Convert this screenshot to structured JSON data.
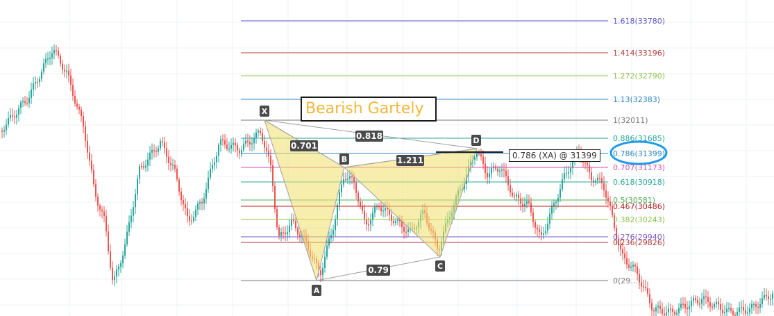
{
  "pattern_title": "Bearish Gartely",
  "annotation": "0.786 (XA) @ 31399",
  "points": {
    "x": "X",
    "a": "A",
    "b": "B",
    "c": "C",
    "d": "D"
  },
  "ratios": {
    "xb": "0.701",
    "xd": "0.818",
    "bd": "1.211",
    "ac": "0.79"
  },
  "fib_levels": [
    {
      "label": "1.618(33780)",
      "color": "#5a55c8"
    },
    {
      "label": "1.414(33196)",
      "color": "#b23a3a"
    },
    {
      "label": "1.272(32790)",
      "color": "#8bc34a"
    },
    {
      "label": "1.13(32383)",
      "color": "#2e86c1"
    },
    {
      "label": "1(32011)",
      "color": "#777777"
    },
    {
      "label": "0.886(31685)",
      "color": "#26a69a"
    },
    {
      "label": "0.786(31399)",
      "color": "#2e86c1"
    },
    {
      "label": "0.707(31173)",
      "color": "#d14fb2"
    },
    {
      "label": "0.618(30918)",
      "color": "#26a69a"
    },
    {
      "label": "0.5(30581)",
      "color": "#4caf50"
    },
    {
      "label": "0.467(30486)",
      "color": "#b71c1c"
    },
    {
      "label": "0.382(30243)",
      "color": "#8bc34a"
    },
    {
      "label": "0.276(29940)",
      "color": "#7e57c2"
    },
    {
      "label": "0.236(29826)",
      "color": "#b23a3a"
    },
    {
      "label": "0(29...)",
      "color": "#777777"
    }
  ],
  "colors": {
    "candle_up": "#26a69a",
    "candle_down": "#ef5350",
    "pattern_fill": "#f0e06b",
    "highlight": "#1e9be8"
  }
}
